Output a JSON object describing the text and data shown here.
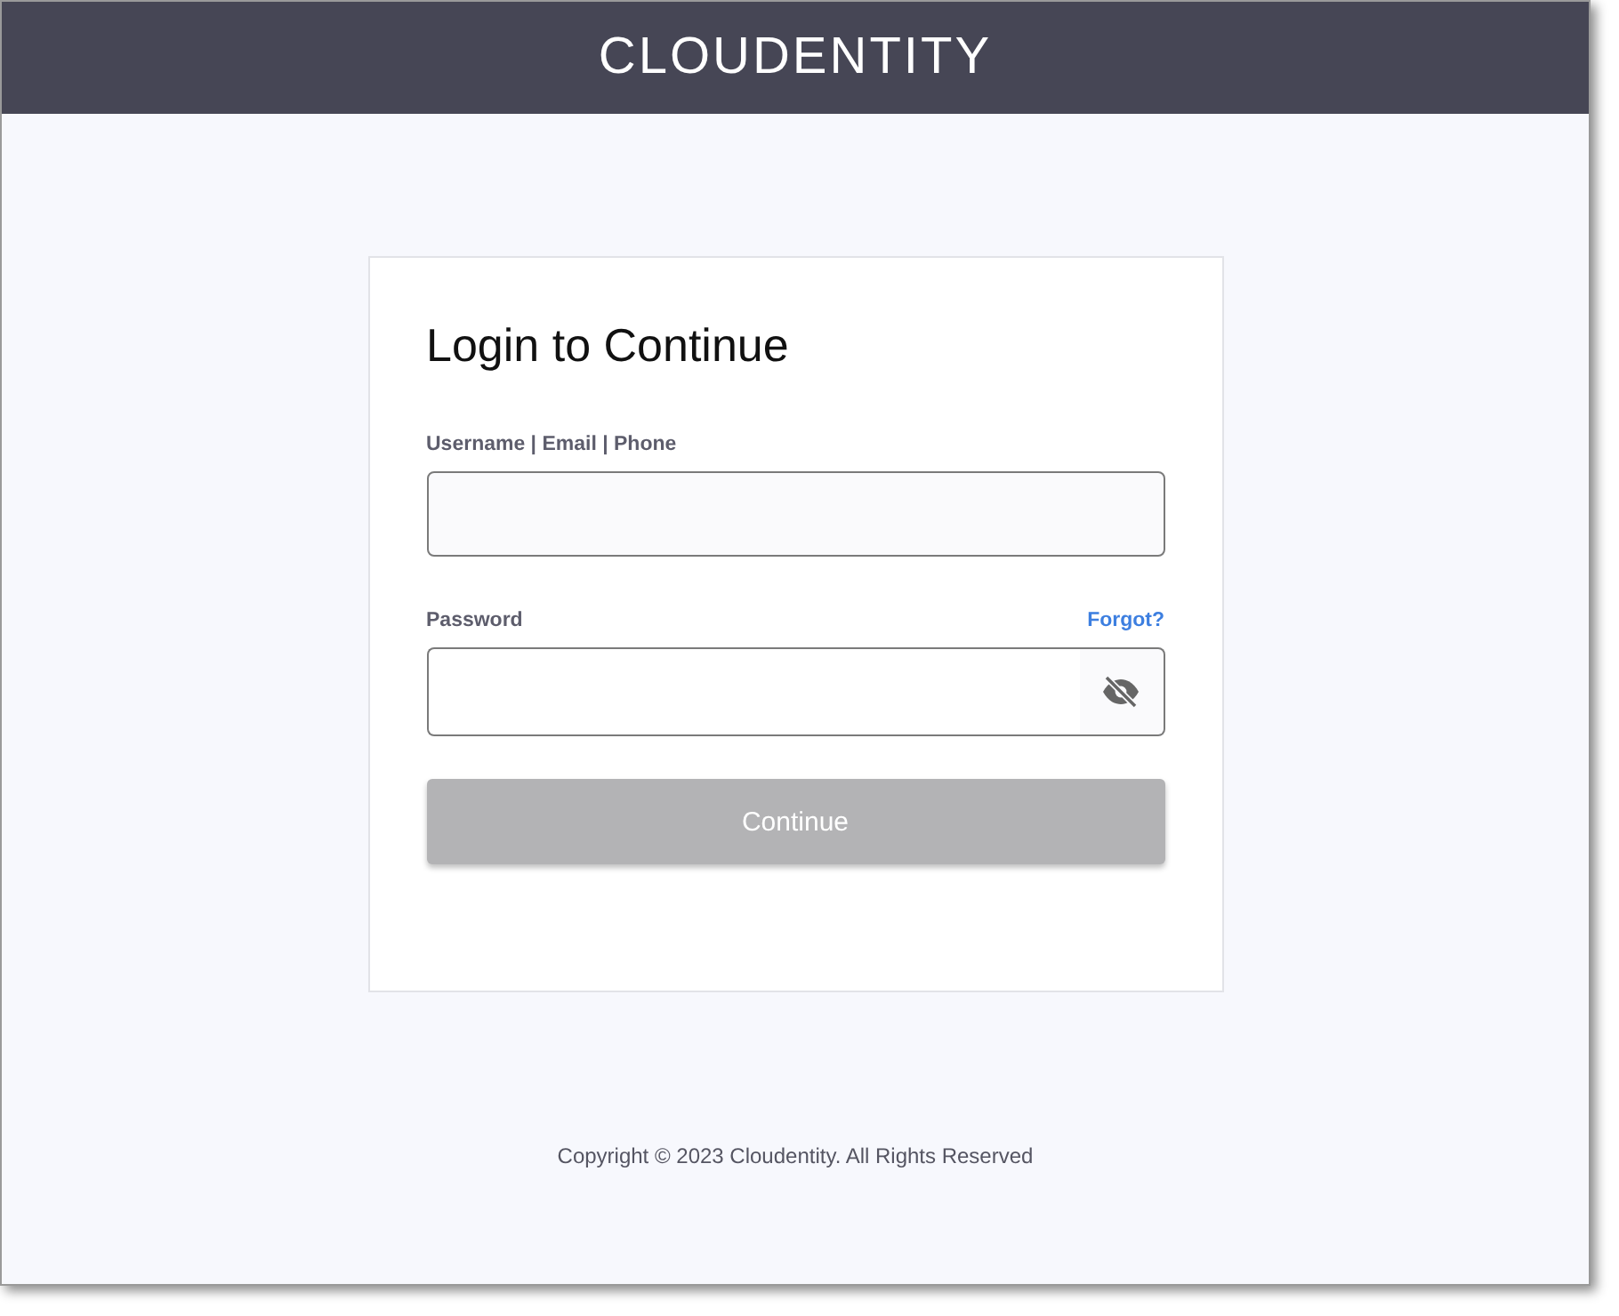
{
  "header": {
    "logo": "CLOUDENTITY"
  },
  "form": {
    "title": "Login to Continue",
    "username": {
      "label": "Username | Email | Phone"
    },
    "password": {
      "label": "Password",
      "forgot_link": "Forgot?",
      "visible": false
    },
    "submit": {
      "label": "Continue",
      "disabled": true
    }
  },
  "footer": {
    "copyright": "Copyright © 2023 Cloudentity. All Rights Reserved"
  }
}
